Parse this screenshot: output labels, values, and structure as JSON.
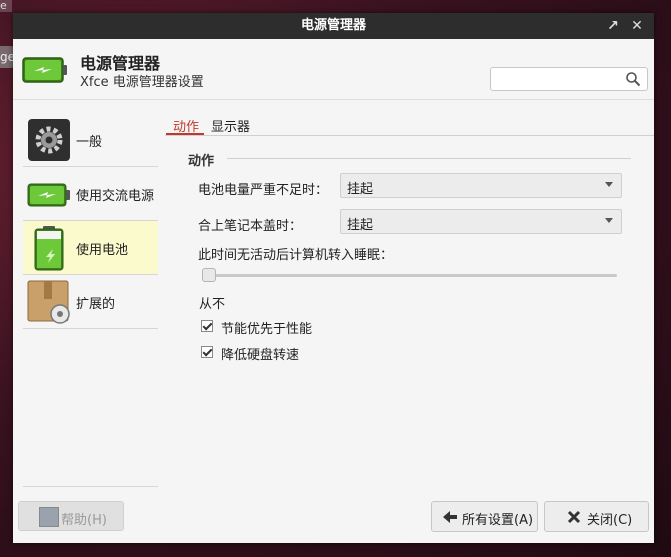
{
  "window": {
    "title": "电源管理器"
  },
  "header": {
    "app_title": "电源管理器",
    "app_subtitle": "Xfce 电源管理器设置",
    "search_placeholder": ""
  },
  "sidebar": {
    "items": [
      {
        "label": "一般",
        "icon": "gear-icon",
        "active": false
      },
      {
        "label": "使用交流电源",
        "icon": "ac-power-icon",
        "active": false
      },
      {
        "label": "使用电池",
        "icon": "battery-icon",
        "active": true
      },
      {
        "label": "扩展的",
        "icon": "package-settings-icon",
        "active": false
      }
    ]
  },
  "tabs": [
    {
      "label": "动作",
      "active": true
    },
    {
      "label": "显示器",
      "active": false
    }
  ],
  "section": {
    "title": "动作"
  },
  "rows": {
    "critical_battery": {
      "label": "电池电量严重不足时：",
      "value": "挂起"
    },
    "lid_close": {
      "label": "合上笔记本盖时：",
      "value": "挂起"
    }
  },
  "sleep": {
    "label": "此时间无活动后计算机转入睡眠：",
    "value_text": "从不",
    "level": 0
  },
  "checks": [
    {
      "label": "节能优先于性能",
      "checked": true
    },
    {
      "label": "降低硬盘转速",
      "checked": true
    }
  ],
  "footer": {
    "help_label": "帮助(H)",
    "all_settings_label": "所有设置(A)",
    "close_label": "关闭(C)"
  },
  "colors": {
    "accent": "#c0392b",
    "active_sidebar": "#fafacd",
    "titlebar": "#2d2d2d",
    "battery_green": "#5fbf2f"
  }
}
